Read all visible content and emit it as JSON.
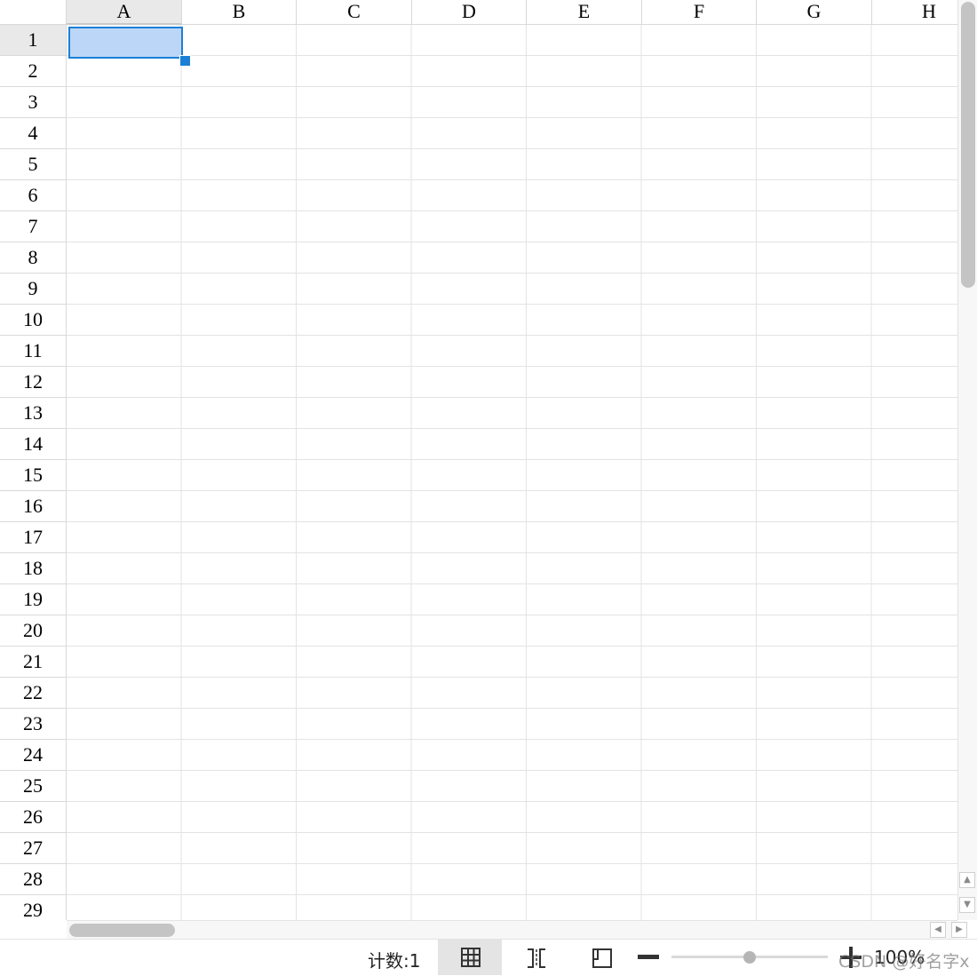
{
  "sheet": {
    "columns": [
      "A",
      "B",
      "C",
      "D",
      "E",
      "F",
      "G",
      "H"
    ],
    "rows": [
      "1",
      "2",
      "3",
      "4",
      "5",
      "6",
      "7",
      "8",
      "9",
      "10",
      "11",
      "12",
      "13",
      "14",
      "15",
      "16",
      "17",
      "18",
      "19",
      "20",
      "21",
      "22",
      "23",
      "24",
      "25",
      "26",
      "27",
      "28",
      "29"
    ],
    "active_column": "A",
    "active_row": "1"
  },
  "statusbar": {
    "count_label": "计数:1",
    "zoom_level": "100%",
    "watermark": "CSDN @好名字x"
  },
  "icons": {
    "normal_view": "grid-view-icon",
    "page_break_view": "page-break-view-icon",
    "page_layout_view": "page-layout-view-icon",
    "zoom_out": "minus-icon",
    "zoom_in": "plus-icon"
  },
  "colors": {
    "selection_border": "#1b7fd6",
    "selection_fill": "#bcd6f7",
    "gridline": "#e3e3e3"
  }
}
